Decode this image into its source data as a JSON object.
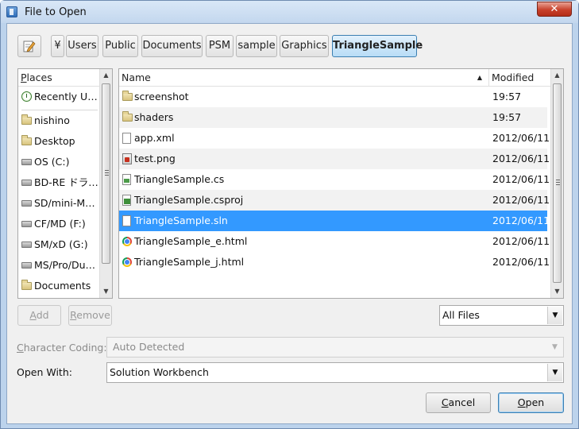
{
  "window": {
    "title": "File to Open",
    "close_glyph": "✕"
  },
  "breadcrumbs": {
    "edit_icon": "pencil-icon",
    "items": [
      "¥",
      "Users",
      "Public",
      "Documents",
      "PSM",
      "sample",
      "Graphics",
      "TriangleSample"
    ],
    "active_index": 7
  },
  "places": {
    "header": "Places",
    "items": [
      {
        "label": "Recently U…",
        "icon": "clock-icon"
      },
      {
        "label": "nishino",
        "icon": "folder-icon"
      },
      {
        "label": "Desktop",
        "icon": "folder-icon"
      },
      {
        "label": "OS (C:)",
        "icon": "drive-icon"
      },
      {
        "label": "BD-RE ドラ…",
        "icon": "optical-drive-icon"
      },
      {
        "label": "SD/mini-M…",
        "icon": "drive-icon"
      },
      {
        "label": "CF/MD (F:)",
        "icon": "drive-icon"
      },
      {
        "label": "SM/xD (G:)",
        "icon": "drive-icon"
      },
      {
        "label": "MS/Pro/Du…",
        "icon": "drive-icon"
      },
      {
        "label": "Documents",
        "icon": "folder-icon"
      }
    ]
  },
  "files": {
    "columns": {
      "name": "Name",
      "modified": "Modified",
      "sort_glyph": "▲"
    },
    "rows": [
      {
        "name": "screenshot",
        "modified": "19:57",
        "icon": "folder-icon"
      },
      {
        "name": "shaders",
        "modified": "19:57",
        "icon": "folder-icon"
      },
      {
        "name": "app.xml",
        "modified": "2012/06/11",
        "icon": "document-icon"
      },
      {
        "name": "test.png",
        "modified": "2012/06/11",
        "icon": "image-icon"
      },
      {
        "name": "TriangleSample.cs",
        "modified": "2012/06/11",
        "icon": "csharp-file-icon"
      },
      {
        "name": "TriangleSample.csproj",
        "modified": "2012/06/11",
        "icon": "csproj-file-icon"
      },
      {
        "name": "TriangleSample.sln",
        "modified": "2012/06/11",
        "icon": "document-icon"
      },
      {
        "name": "TriangleSample_e.html",
        "modified": "2012/06/11",
        "icon": "chrome-icon"
      },
      {
        "name": "TriangleSample_j.html",
        "modified": "2012/06/11",
        "icon": "chrome-icon"
      }
    ],
    "selected_index": 6
  },
  "buttons": {
    "add": {
      "label": "Add",
      "mnemonic": "A",
      "rest": "dd"
    },
    "remove": {
      "label": "Remove",
      "mnemonic": "R",
      "rest": "emove"
    },
    "cancel": {
      "label": "Cancel",
      "mnemonic": "C",
      "rest": "ancel"
    },
    "open": {
      "label": "Open",
      "mnemonic": "O",
      "rest": "pen"
    }
  },
  "filter": {
    "value": "All Files"
  },
  "character_coding": {
    "label": "Character Coding:",
    "mnemonic": "C",
    "rest": "haracter Coding:",
    "value": "Auto Detected"
  },
  "open_with": {
    "label": "Open With:",
    "value": "Solution Workbench"
  },
  "colors": {
    "selection": "#3399ff",
    "active_crumb": "#b8dcf6",
    "close_button": "#c8412b",
    "dialog_background": "#f0f0f0"
  }
}
